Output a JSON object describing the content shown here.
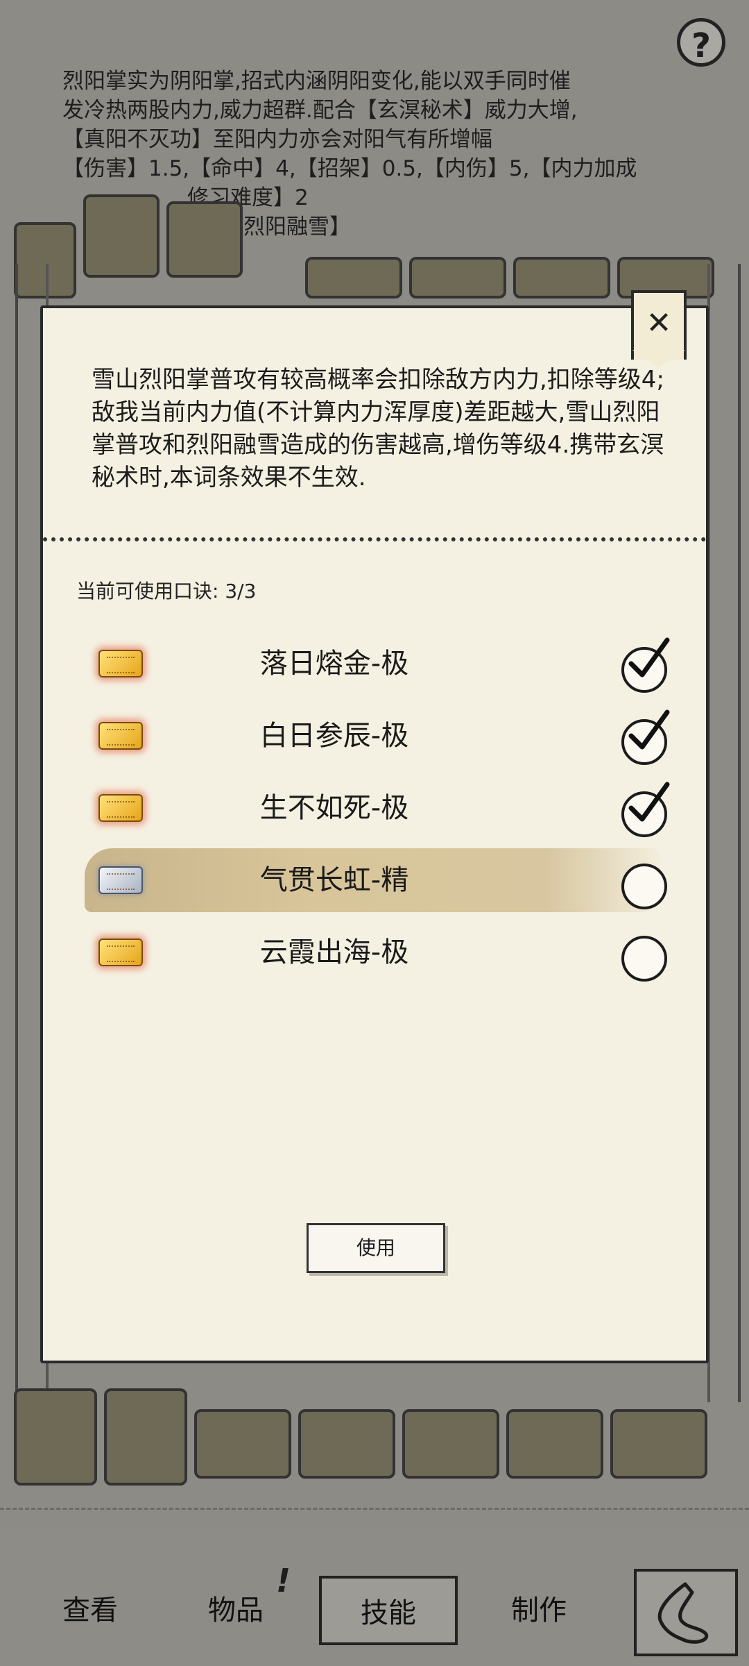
{
  "background": {
    "help_label": "?",
    "skill_description": [
      "烈阳掌实为阴阳掌,招式内涵阴阳变化,能以双手同时催",
      "发冷热两股内力,威力超群.配合【玄溟秘术】威力大增,",
      "【真阳不灭功】至阳内力亦会对阳气有所增幅",
      "【伤害】1.5,【命中】4,【招架】0.5,【内伤】5,【内力加成",
      "修习难度】2",
      "【烈阳融雪】"
    ]
  },
  "modal": {
    "close_icon": "close-icon",
    "effect_text": "雪山烈阳掌普攻有较高概率会扣除敌方内力,扣除等级4; 敌我当前内力值(不计算内力浑厚度)差距越大,雪山烈阳掌普攻和烈阳融雪造成的伤害越高,增伤等级4.携带玄溟秘术时,本词条效果不生效.",
    "slots_label": "当前可使用口诀: 3/3",
    "options": [
      {
        "name": "落日熔金-极",
        "token": "gold",
        "checked": true,
        "highlighted": false
      },
      {
        "name": "白日参辰-极",
        "token": "gold",
        "checked": true,
        "highlighted": false
      },
      {
        "name": "生不如死-极",
        "token": "gold",
        "checked": true,
        "highlighted": false
      },
      {
        "name": "气贯长虹-精",
        "token": "silver",
        "checked": false,
        "highlighted": true
      },
      {
        "name": "云霞出海-极",
        "token": "gold",
        "checked": false,
        "highlighted": false
      }
    ],
    "use_button_label": "使用"
  },
  "bottom_nav": {
    "items": [
      {
        "label": "查看",
        "active": false
      },
      {
        "label": "物品",
        "active": false
      },
      {
        "label": "技能",
        "active": true
      },
      {
        "label": "制作",
        "active": false
      }
    ],
    "badge": "!",
    "back_icon": "back-icon"
  },
  "colors": {
    "panel": "#f5f1e2",
    "dim_background": "#8d8c87",
    "gold_token": "#e6a51b",
    "silver_token": "#a9b3c2",
    "highlight": "#d2bf93"
  }
}
